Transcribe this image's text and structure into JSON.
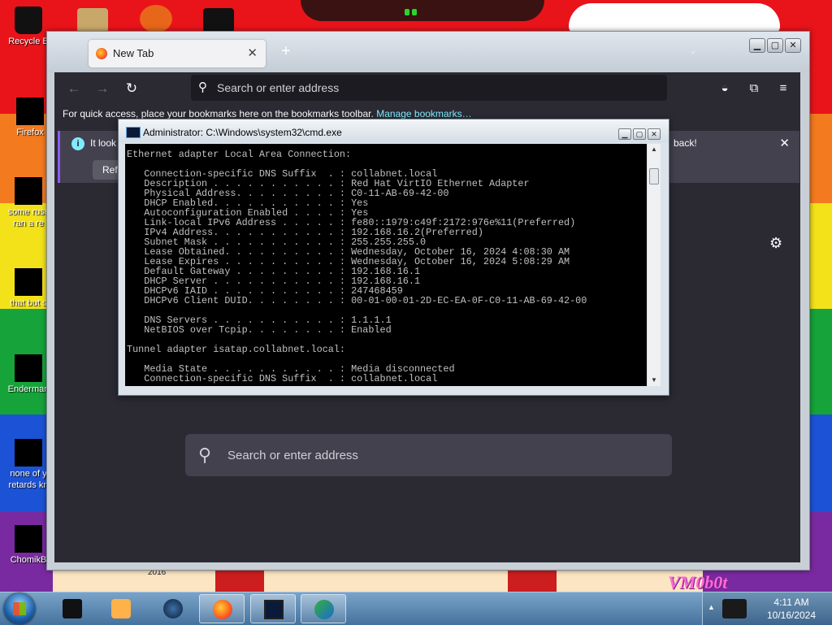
{
  "desktop": {
    "icons": [
      {
        "label": "Recycle B",
        "name": "desktop-icon-recycle-bin"
      },
      {
        "label": "Firefox",
        "name": "desktop-icon-firefox"
      },
      {
        "label": "some russ",
        "label2": "ran a re",
        "name": "desktop-icon-some-russ"
      },
      {
        "label": "that but s",
        "name": "desktop-icon-that-but"
      },
      {
        "label": "Enderman",
        "name": "desktop-icon-enderman"
      },
      {
        "label": "none of y",
        "label2": "retards kn",
        "name": "desktop-icon-none-of-y"
      },
      {
        "label": "ChomikB",
        "name": "desktop-icon-chomik"
      }
    ],
    "wallpaper_tag": "VM0b0t",
    "wallpaper_year": "2016"
  },
  "firefox": {
    "tab_label": "New Tab",
    "url_placeholder": "Search or enter address",
    "bookmarks_text": "For quick access, place your bookmarks here on the bookmarks toolbar.",
    "bookmarks_link": "Manage bookmarks…",
    "notice_text": "It look",
    "notice_text_end": "back!",
    "notice_button": "Refr",
    "search_placeholder": "Search or enter address"
  },
  "cmd": {
    "title": "Administrator: C:\\Windows\\system32\\cmd.exe",
    "lines": [
      "Ethernet adapter Local Area Connection:",
      "",
      "   Connection-specific DNS Suffix  . : collabnet.local",
      "   Description . . . . . . . . . . . : Red Hat VirtIO Ethernet Adapter",
      "   Physical Address. . . . . . . . . : C0-11-AB-69-42-00",
      "   DHCP Enabled. . . . . . . . . . . : Yes",
      "   Autoconfiguration Enabled . . . . : Yes",
      "   Link-local IPv6 Address . . . . . : fe80::1979:c49f:2172:976e%11(Preferred)",
      "   IPv4 Address. . . . . . . . . . . : 192.168.16.2(Preferred)",
      "   Subnet Mask . . . . . . . . . . . : 255.255.255.0",
      "   Lease Obtained. . . . . . . . . . : Wednesday, October 16, 2024 4:08:30 AM",
      "   Lease Expires . . . . . . . . . . : Wednesday, October 16, 2024 5:08:29 AM",
      "   Default Gateway . . . . . . . . . : 192.168.16.1",
      "   DHCP Server . . . . . . . . . . . : 192.168.16.1",
      "   DHCPv6 IAID . . . . . . . . . . . : 247468459",
      "   DHCPv6 Client DUID. . . . . . . . : 00-01-00-01-2D-EC-EA-0F-C0-11-AB-69-42-00",
      "",
      "   DNS Servers . . . . . . . . . . . : 1.1.1.1",
      "   NetBIOS over Tcpip. . . . . . . . : Enabled",
      "",
      "Tunnel adapter isatap.collabnet.local:",
      "",
      "   Media State . . . . . . . . . . . : Media disconnected",
      "   Connection-specific DNS Suffix  . : collabnet.local"
    ]
  },
  "taskbar": {
    "items": [
      {
        "name": "taskbar-item-cmd-black",
        "icon": "terminal-icon"
      },
      {
        "name": "taskbar-item-media",
        "icon": "media-player-icon"
      },
      {
        "name": "taskbar-item-globe",
        "icon": "globe-icon"
      },
      {
        "name": "taskbar-item-firefox",
        "icon": "firefox-icon"
      },
      {
        "name": "taskbar-item-cmd",
        "icon": "cmd-icon"
      },
      {
        "name": "taskbar-item-downloader",
        "icon": "download-manager-icon"
      }
    ],
    "time": "4:11 AM",
    "date": "10/16/2024"
  }
}
